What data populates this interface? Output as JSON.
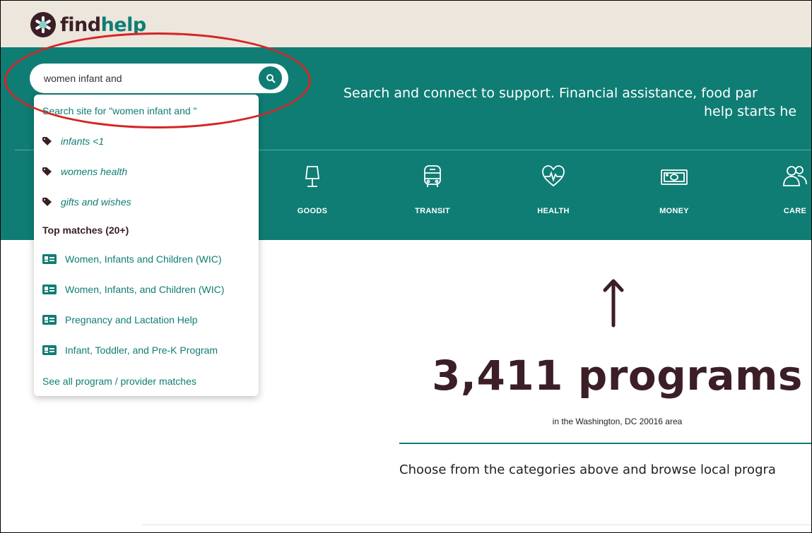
{
  "brand": {
    "name_part1": "find",
    "name_part2": "help",
    "color_dark": "#3b1e26",
    "color_teal": "#0f7d74"
  },
  "search": {
    "value": "women infant and",
    "button_icon": "search-icon"
  },
  "hero": {
    "tagline_line1": "Search and connect to support. Financial assistance, food par",
    "tagline_line2": "help starts he",
    "categories": [
      {
        "label": "GOODS",
        "icon": "lamp-icon"
      },
      {
        "label": "TRANSIT",
        "icon": "bus-icon"
      },
      {
        "label": "HEALTH",
        "icon": "heart-pulse-icon"
      },
      {
        "label": "MONEY",
        "icon": "money-icon"
      },
      {
        "label": "CARE",
        "icon": "people-icon"
      }
    ]
  },
  "dropdown": {
    "search_site": "Search site for \"women infant and \"",
    "tags": [
      "infants <1",
      "womens health",
      "gifts and wishes"
    ],
    "top_matches_heading": "Top matches (20+)",
    "programs": [
      "Women, Infants and Children (WIC)",
      "Women, Infants, and Children (WIC)",
      "Pregnancy and Lactation Help",
      "Infant, Toddler, and Pre-K Program"
    ],
    "see_all": "See all program / provider matches"
  },
  "main": {
    "count": "3,411 programs",
    "area": "in the Washington, DC 20016 area",
    "choose": "Choose from the categories above and browse local progra"
  },
  "annotation": {
    "highlight_color": "#d52525"
  }
}
